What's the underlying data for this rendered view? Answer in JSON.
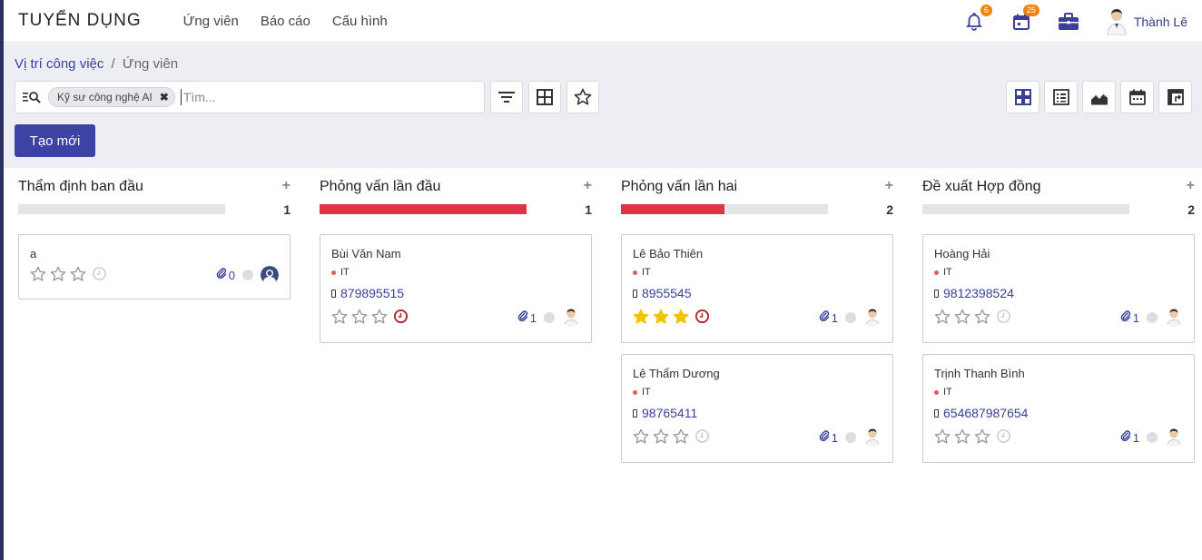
{
  "app": {
    "title": "TUYỂN DỤNG"
  },
  "menu": [
    "Ứng viên",
    "Báo cáo",
    "Cấu hình"
  ],
  "nav": {
    "notifications_badge": "6",
    "activities_badge": "25",
    "user_name": "Thành Lê",
    "badge_color": "#f0840f"
  },
  "breadcrumb": {
    "parent": "Vị trí công việc",
    "separator": "/",
    "current": "Ứng viên"
  },
  "search": {
    "facet_label": "Kỹ sư công nghệ AI",
    "placeholder": "Tìm..."
  },
  "toolbar": {
    "create_label": "Tạo mới",
    "filter_icon": "filter-icon",
    "groupby_icon": "groupby-icon",
    "favorite_icon": "star-icon"
  },
  "views": [
    "kanban",
    "list",
    "graph",
    "calendar",
    "pivot"
  ],
  "colors": {
    "accent": "#3c43a4",
    "link": "#3a3f99",
    "danger": "#dc3545",
    "star_on": "#f3c300",
    "deadline": "#b5262d"
  },
  "columns": [
    {
      "title": "Thẩm định ban đầu",
      "count": "1",
      "progress": 0,
      "cards": [
        {
          "name": "a",
          "tag": "",
          "phone": "",
          "stars": 0,
          "deadline": false,
          "attachments": "0",
          "avatar": "default"
        }
      ]
    },
    {
      "title": "Phỏng vấn lần đầu",
      "count": "1",
      "progress": 1,
      "cards": [
        {
          "name": "Bùi Văn Nam",
          "tag": "IT",
          "phone": "879895515",
          "stars": 0,
          "deadline": true,
          "attachments": "1",
          "avatar": "user"
        }
      ]
    },
    {
      "title": "Phỏng vấn lần hai",
      "count": "2",
      "progress": 0.5,
      "cards": [
        {
          "name": "Lê Bảo Thiên",
          "tag": "IT",
          "phone": "8955545",
          "stars": 3,
          "deadline": true,
          "attachments": "1",
          "avatar": "user"
        },
        {
          "name": "Lê Thẩm Dương",
          "tag": "IT",
          "phone": "98765411",
          "stars": 0,
          "deadline": false,
          "attachments": "1",
          "avatar": "user"
        }
      ]
    },
    {
      "title": "Đề xuất Hợp đồng",
      "count": "2",
      "progress": 0,
      "cards": [
        {
          "name": "Hoàng Hải",
          "tag": "IT",
          "phone": "9812398524",
          "stars": 0,
          "deadline": false,
          "attachments": "1",
          "avatar": "user"
        },
        {
          "name": "Trịnh Thanh Bình",
          "tag": "IT",
          "phone": "654687987654",
          "stars": 0,
          "deadline": false,
          "attachments": "1",
          "avatar": "user"
        }
      ]
    }
  ]
}
